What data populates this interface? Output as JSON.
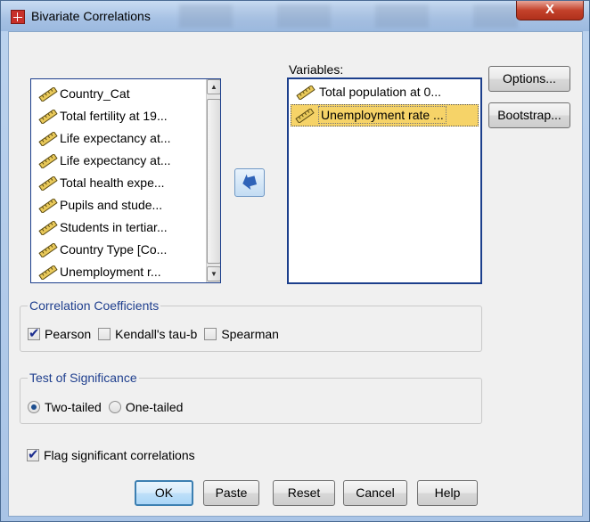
{
  "window": {
    "title": "Bivariate Correlations",
    "close_label": "X"
  },
  "source_list": {
    "items": [
      "Country_Cat",
      "Total fertility at 19...",
      "Life expectancy at...",
      "Life expectancy at...",
      "Total health expe...",
      "Pupils and stude...",
      "Students in tertiar...",
      "Country Type [Co...",
      "Unemployment r..."
    ]
  },
  "variables": {
    "label": "Variables:",
    "items": [
      "Total population at 0...",
      "Unemployment rate ..."
    ],
    "selected_index": 1
  },
  "side_buttons": {
    "options": "Options...",
    "bootstrap": "Bootstrap..."
  },
  "correlation_coefficients": {
    "title": "Correlation Coefficients",
    "pearson": {
      "label": "Pearson",
      "checked": true
    },
    "kendall": {
      "label": "Kendall's tau-b",
      "checked": false
    },
    "spearman": {
      "label": "Spearman",
      "checked": false
    }
  },
  "test_of_significance": {
    "title": "Test of Significance",
    "two_tailed": {
      "label": "Two-tailed",
      "checked": true
    },
    "one_tailed": {
      "label": "One-tailed",
      "checked": false
    }
  },
  "flag_significant": {
    "label": "Flag significant correlations",
    "checked": true
  },
  "bottom_buttons": {
    "ok": "OK",
    "paste": "Paste",
    "reset": "Reset",
    "cancel": "Cancel",
    "help": "Help"
  },
  "colors": {
    "accent": "#1c3f8c",
    "selection": "#f6d368",
    "group_title": "#1f3f8e"
  },
  "icons": {
    "variable": "scale-ruler-icon",
    "move": "arrow-left-icon"
  }
}
